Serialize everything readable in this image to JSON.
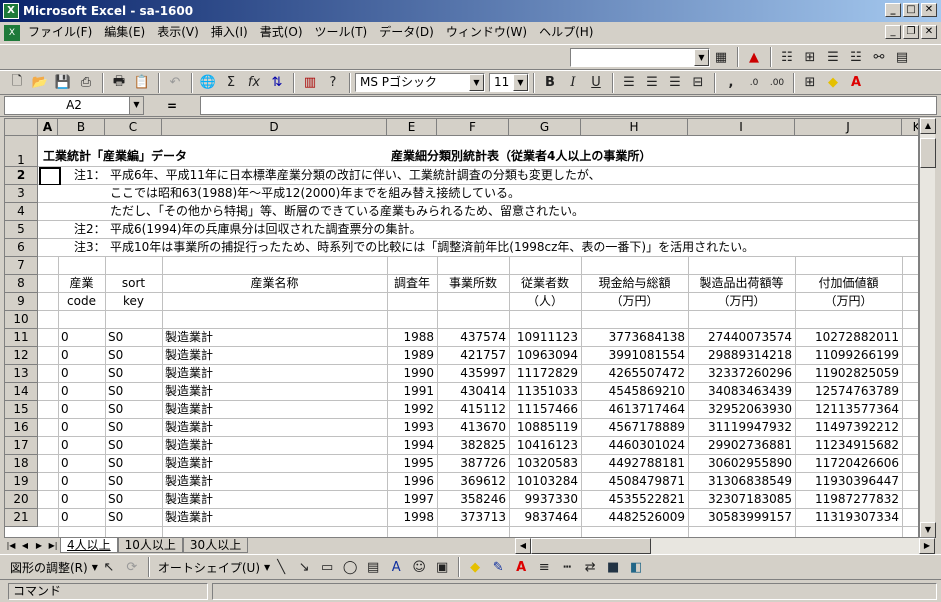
{
  "window": {
    "title": "Microsoft Excel - sa-1600",
    "app_icon": "excel-icon"
  },
  "menu": [
    "ファイル(F)",
    "編集(E)",
    "表示(V)",
    "挿入(I)",
    "書式(O)",
    "ツール(T)",
    "データ(D)",
    "ウィンドウ(W)",
    "ヘルプ(H)"
  ],
  "format_toolbar": {
    "font": "MS Pゴシック",
    "size": "11"
  },
  "formula_bar": {
    "name_box": "A2",
    "equals": "=",
    "content": ""
  },
  "columns": [
    "A",
    "B",
    "C",
    "D",
    "E",
    "F",
    "G",
    "H",
    "I",
    "J",
    "K"
  ],
  "text_rows": {
    "r1": {
      "row": "1",
      "b": "工業統計「産業編」データ",
      "e": "産業細分類別統計表（従業者4人以上の事業所）"
    },
    "r2": {
      "row": "2",
      "b": "注1：",
      "c": "平成6年、平成11年に日本標準産業分類の改訂に伴い、工業統計調査の分類も変更したが、"
    },
    "r3": {
      "row": "3",
      "c": "ここでは昭和63(1988)年～平成12(2000)年までを組み替え接続している。"
    },
    "r4": {
      "row": "4",
      "c": "ただし、「その他から特掲」等、断層のできている産業もみられるため、留意されたい。"
    },
    "r5": {
      "row": "5",
      "b": "注2：",
      "c": "平成6(1994)年の兵庫県分は回収された調査票分の集計。"
    },
    "r6": {
      "row": "6",
      "b": "注3：",
      "c": "平成10年は事業所の捕捉行ったため、時系列での比較には「調整済前年比(1998cz年、表の一番下)」を活用されたい。"
    },
    "r7": {
      "row": "7"
    },
    "r8": {
      "row": "8",
      "b": "産業",
      "c": "sort",
      "d": "産業名称",
      "e": "調査年",
      "f": "事業所数",
      "g": "従業者数",
      "h": "現金給与総額",
      "i": "製造品出荷額等",
      "j": "付加価値額"
    },
    "r9": {
      "row": "9",
      "b": "code",
      "c": "key",
      "g": "（人）",
      "h": "（万円）",
      "i": "（万円）",
      "j": "（万円）"
    },
    "r10": {
      "row": "10"
    }
  },
  "data_rows": [
    {
      "row": "11",
      "code": "0",
      "key": "S0",
      "name": "製造業計",
      "year": "1988",
      "est": "437574",
      "emp": "10911123",
      "pay": "3773684138",
      "ship": "27440073574",
      "val": "10272882011"
    },
    {
      "row": "12",
      "code": "0",
      "key": "S0",
      "name": "製造業計",
      "year": "1989",
      "est": "421757",
      "emp": "10963094",
      "pay": "3991081554",
      "ship": "29889314218",
      "val": "11099266199"
    },
    {
      "row": "13",
      "code": "0",
      "key": "S0",
      "name": "製造業計",
      "year": "1990",
      "est": "435997",
      "emp": "11172829",
      "pay": "4265507472",
      "ship": "32337260296",
      "val": "11902825059"
    },
    {
      "row": "14",
      "code": "0",
      "key": "S0",
      "name": "製造業計",
      "year": "1991",
      "est": "430414",
      "emp": "11351033",
      "pay": "4545869210",
      "ship": "34083463439",
      "val": "12574763789"
    },
    {
      "row": "15",
      "code": "0",
      "key": "S0",
      "name": "製造業計",
      "year": "1992",
      "est": "415112",
      "emp": "11157466",
      "pay": "4613717464",
      "ship": "32952063930",
      "val": "12113577364"
    },
    {
      "row": "16",
      "code": "0",
      "key": "S0",
      "name": "製造業計",
      "year": "1993",
      "est": "413670",
      "emp": "10885119",
      "pay": "4567178889",
      "ship": "31119947932",
      "val": "11497392212"
    },
    {
      "row": "17",
      "code": "0",
      "key": "S0",
      "name": "製造業計",
      "year": "1994",
      "est": "382825",
      "emp": "10416123",
      "pay": "4460301024",
      "ship": "29902736881",
      "val": "11234915682"
    },
    {
      "row": "18",
      "code": "0",
      "key": "S0",
      "name": "製造業計",
      "year": "1995",
      "est": "387726",
      "emp": "10320583",
      "pay": "4492788181",
      "ship": "30602955890",
      "val": "11720426606"
    },
    {
      "row": "19",
      "code": "0",
      "key": "S0",
      "name": "製造業計",
      "year": "1996",
      "est": "369612",
      "emp": "10103284",
      "pay": "4508479871",
      "ship": "31306838549",
      "val": "11930396447"
    },
    {
      "row": "20",
      "code": "0",
      "key": "S0",
      "name": "製造業計",
      "year": "1997",
      "est": "358246",
      "emp": "9937330",
      "pay": "4535522821",
      "ship": "32307183085",
      "val": "11987277832"
    },
    {
      "row": "21",
      "code": "0",
      "key": "S0",
      "name": "製造業計",
      "year": "1998",
      "est": "373713",
      "emp": "9837464",
      "pay": "4482526009",
      "ship": "30583999157",
      "val": "11319307334"
    }
  ],
  "sheet_tabs": [
    "4人以上",
    "10人以上",
    "30人以上"
  ],
  "drawing_toolbar": {
    "draw": "図形の調整(R)",
    "autoshape": "オートシェイプ(U)"
  },
  "status": "コマンド",
  "colors": {
    "title_start": "#0a246a",
    "title_end": "#a6caf0",
    "face": "#d4d0c8"
  }
}
